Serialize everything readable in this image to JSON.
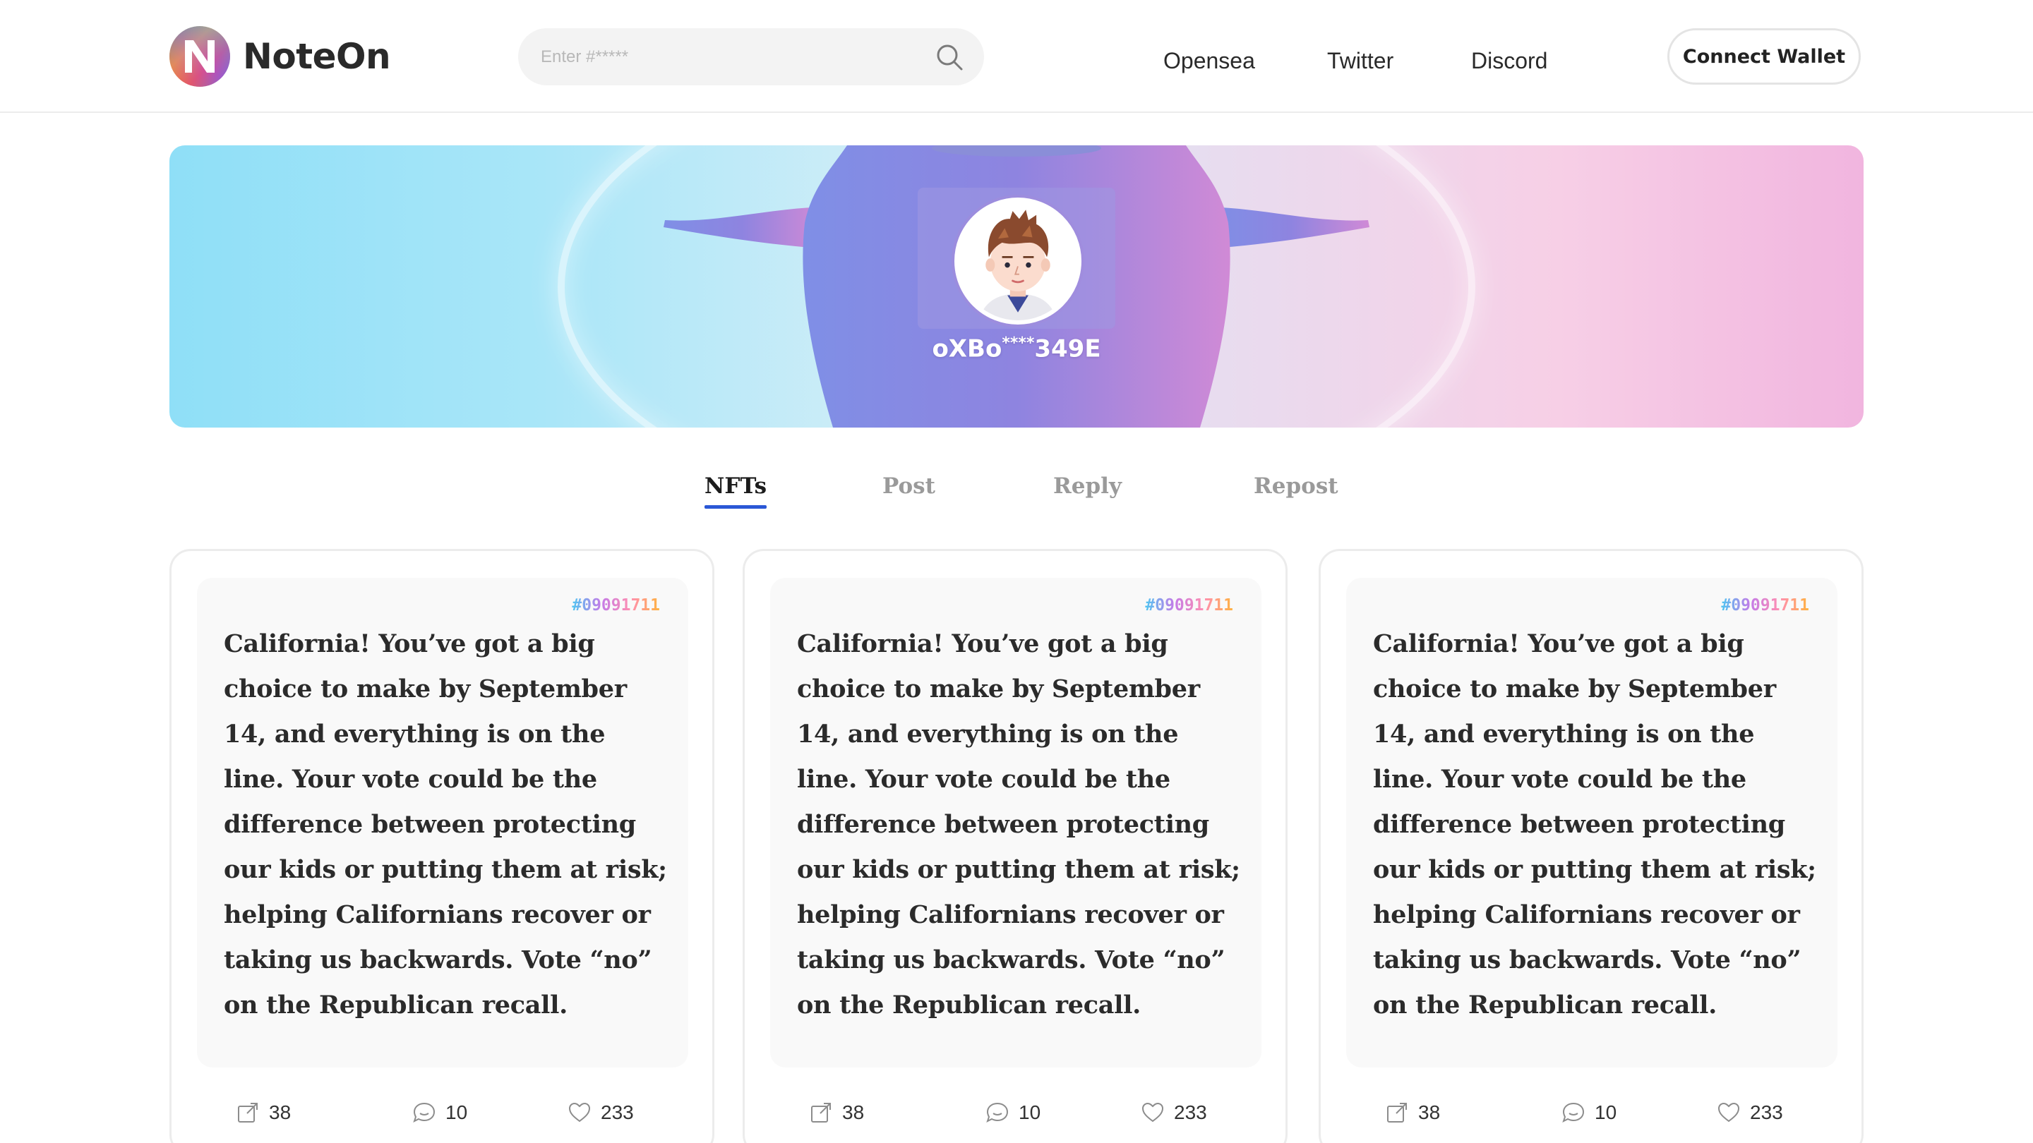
{
  "header": {
    "logo_text": "NoteOn",
    "search_placeholder": "Enter #*****",
    "nav": [
      "Opensea",
      "Twitter",
      "Discord"
    ],
    "connect_label": "Connect Wallet"
  },
  "profile": {
    "address_prefix": "oXBo",
    "address_mask": "****",
    "address_suffix": "349E"
  },
  "tabs": [
    {
      "label": "NFTs",
      "active": true
    },
    {
      "label": "Post",
      "active": false
    },
    {
      "label": "Reply",
      "active": false
    },
    {
      "label": "Repost",
      "active": false
    }
  ],
  "cards": [
    {
      "tag": "#09091711",
      "text": "California! You’ve got a big choice to make by September 14, and everything is on the line. Your vote could be the difference between protecting our kids or putting them at risk; helping Californians recover or taking us backwards. Vote “no” on the Republican recall.",
      "shares": "38",
      "comments": "10",
      "likes": "233"
    },
    {
      "tag": "#09091711",
      "text": "California! You’ve got a big choice to make by September 14, and everything is on the line. Your vote could be the difference between protecting our kids or putting them at risk; helping Californians recover or taking us backwards. Vote “no” on the Republican recall.",
      "shares": "38",
      "comments": "10",
      "likes": "233"
    },
    {
      "tag": "#09091711",
      "text": "California! You’ve got a big choice to make by September 14, and everything is on the line. Your vote could be the difference between protecting our kids or putting them at risk; helping Californians recover or taking us backwards. Vote “no” on the Republican recall.",
      "shares": "38",
      "comments": "10",
      "likes": "233"
    }
  ],
  "icons": {
    "search": "search-icon",
    "share": "share-icon",
    "comment": "comment-icon",
    "like": "heart-icon"
  },
  "colors": {
    "tab_accent": "#2a57d6",
    "banner_left": "#8fdff7",
    "banner_right": "#f1b5df",
    "figure": "#8f86e0"
  }
}
